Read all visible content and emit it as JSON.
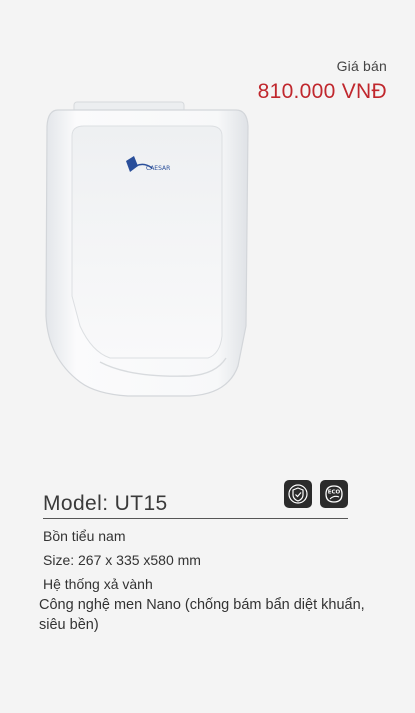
{
  "price": {
    "label": "Giá bán",
    "value": "810.000 VNĐ"
  },
  "product": {
    "logo_text": "CAESAR",
    "image_icon": "urinal-image"
  },
  "model": {
    "title": "Model: UT15",
    "badges": [
      {
        "icon": "shield-check-icon"
      },
      {
        "icon": "eco-leaf-icon",
        "text": "ECO"
      }
    ]
  },
  "specs": {
    "type": "Bồn tiểu nam",
    "size": "Size: 267 x 335 x580 mm",
    "flush": "Hệ thống xả vành",
    "technology": "Công nghệ men Nano (chống bám bẩn diệt khuẩn, siêu bền)"
  },
  "colors": {
    "price": "#c0272d",
    "badge_bg": "#2b2b2b",
    "background": "#f4f4f4"
  }
}
